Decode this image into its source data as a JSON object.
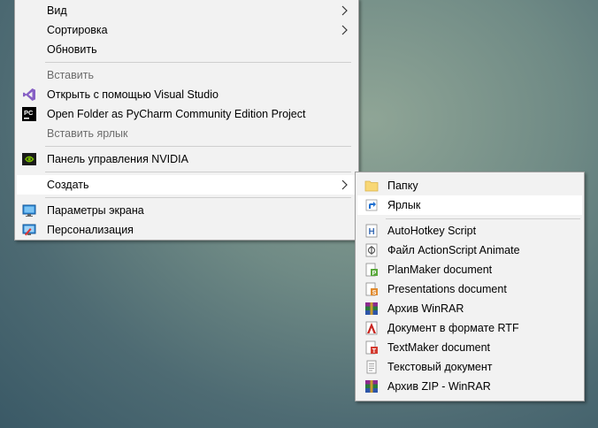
{
  "context_menu": {
    "items": [
      {
        "label": "Вид"
      },
      {
        "label": "Сортировка"
      },
      {
        "label": "Обновить"
      },
      {
        "label": "Вставить"
      },
      {
        "label": "Открыть с помощью Visual Studio"
      },
      {
        "label": "Open Folder as PyCharm Community Edition Project"
      },
      {
        "label": "Вставить ярлык"
      },
      {
        "label": "Панель управления NVIDIA"
      },
      {
        "label": "Создать"
      },
      {
        "label": "Параметры экрана"
      },
      {
        "label": "Персонализация"
      }
    ]
  },
  "new_submenu": {
    "items": [
      {
        "label": "Папку"
      },
      {
        "label": "Ярлык"
      },
      {
        "label": "AutoHotkey Script"
      },
      {
        "label": "Файл ActionScript Animate"
      },
      {
        "label": "PlanMaker document"
      },
      {
        "label": "Presentations document"
      },
      {
        "label": "Архив WinRAR"
      },
      {
        "label": "Документ в формате RTF"
      },
      {
        "label": "TextMaker document"
      },
      {
        "label": "Текстовый документ"
      },
      {
        "label": "Архив ZIP - WinRAR"
      }
    ]
  },
  "colors": {
    "menu_bg": "#f2f2f2",
    "highlight": "#ffffff",
    "disabled_text": "#6d6d6d",
    "visual_studio": "#865fc5",
    "nvidia": "#76b900",
    "folder": "#f8d775"
  }
}
